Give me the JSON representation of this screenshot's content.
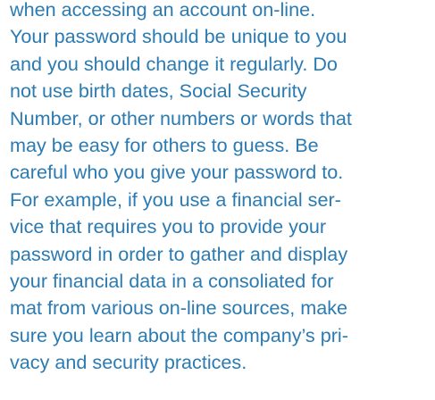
{
  "document": {
    "text_color": "#2b7bb2",
    "background_color": "#ffffff",
    "lines": [
      "when accessing an account on-line.",
      "Your password should be unique to you",
      "and you should change it regularly. Do",
      "not use birth dates, Social Security",
      "Number, or other numbers or words that",
      "may be easy for others to guess. Be",
      "careful who you give your password to.",
      "For example, if you use a financial ser-",
      "vice that requires you to provide your",
      "password in order to gather and display",
      "your financial data in a consoliated for",
      "mat from various on-line sources, make",
      "sure you learn about the company’s pri-",
      "vacy and security practices."
    ]
  }
}
